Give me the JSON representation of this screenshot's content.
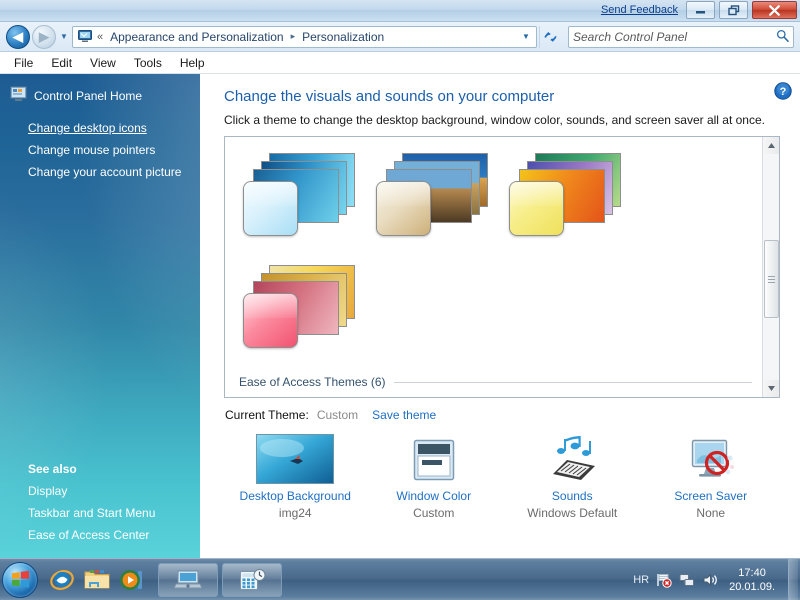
{
  "titlebar": {
    "send_feedback": "Send Feedback",
    "minimize_label": "Minimize",
    "restore_label": "Restore",
    "close_label": "Close"
  },
  "navbar": {
    "back_label": "Back",
    "forward_label": "Forward",
    "recent_dropdown_label": "Recent pages",
    "address_icon": "control-panel-monitor-icon",
    "overflow_chevrons": "«",
    "breadcrumbs": [
      {
        "label": "Appearance and Personalization"
      },
      {
        "label": "Personalization"
      }
    ],
    "breadcrumb_separator": "▸",
    "address_dropdown": "▼",
    "refresh_label": "Refresh",
    "search": {
      "value": "",
      "placeholder": "Search Control Panel",
      "icon": "search-icon"
    }
  },
  "menubar": {
    "items": [
      {
        "label": "File"
      },
      {
        "label": "Edit"
      },
      {
        "label": "View"
      },
      {
        "label": "Tools"
      },
      {
        "label": "Help"
      }
    ]
  },
  "sidebar": {
    "home": {
      "label": "Control Panel Home",
      "icon": "control-panel-home-icon"
    },
    "links": [
      {
        "label": "Change desktop icons",
        "active": true
      },
      {
        "label": "Change mouse pointers",
        "active": false
      },
      {
        "label": "Change your account picture",
        "active": false
      }
    ],
    "see_also_title": "See also",
    "see_also": [
      {
        "label": "Display"
      },
      {
        "label": "Taskbar and Start Menu"
      },
      {
        "label": "Ease of Access Center"
      }
    ]
  },
  "content": {
    "help_label": "Help",
    "title": "Change the visuals and sounds on your computer",
    "subtitle": "Click a theme to change the desktop background, window color, sounds, and screen saver all at once.",
    "themes": [
      {
        "name": "theme-ocean",
        "wallpapers": [
          "linear-gradient(120deg,#1a5f93 0%,#2f93c9 40%,#6fd0ea 100%)",
          "linear-gradient(110deg,#0f4e86 0%,#2b8fc6 45%,#79d6ef 100%)",
          "linear-gradient(100deg,#166ba4 0%,#3aa4d6 50%,#8fe0f5 100%)"
        ],
        "glass": "linear-gradient(140deg,#f2fbff 0%,#d9f1fc 45%,#a8def5 100%)"
      },
      {
        "name": "theme-landscapes",
        "wallpapers": [
          "linear-gradient(to bottom,#6fa8d4 0%,#6fa8d4 35%,#b6894f 36%,#4c3a24 100%)",
          "linear-gradient(to bottom,#74b0d8 0%,#74b0d8 40%,#caa35f 41%,#8a7340 100%)",
          "linear-gradient(to bottom,#1f5fa8 0%,#2c7cc4 45%,#d9a452 46%,#a06a28 100%)"
        ],
        "glass": "linear-gradient(140deg,#f7f3e6 0%,#e9dcc0 45%,#cdb079 100%)"
      },
      {
        "name": "theme-architecture",
        "wallpapers": [
          "linear-gradient(120deg,#f3c419 0%,#f08a1c 45%,#e4541a 100%)",
          "linear-gradient(120deg,#4b4fae 0%,#9a77c4 50%,#d9c3e4 100%)",
          "linear-gradient(120deg,#1d7a58 0%,#41a96f 50%,#b8dc8a 100%)"
        ],
        "glass": "linear-gradient(140deg,#fdf8c8 0%,#f7ee8a 45%,#efe05a 100%)"
      },
      {
        "name": "theme-nature",
        "wallpapers": [
          "linear-gradient(120deg,#b2465c 0%,#d4707f 45%,#efb6bf 100%)",
          "linear-gradient(120deg,#c4922c 0%,#dbb24d 45%,#f0da8c 100%)",
          "linear-gradient(120deg,#f0e3a8 0%,#f6d85c 40%,#e8a83a 100%)"
        ],
        "glass": "linear-gradient(140deg,#ffd5dd 0%,#fb8b9f 45%,#f1526f 100%)"
      }
    ],
    "group_header": "Ease of Access Themes (6)",
    "current_theme_label": "Current Theme:",
    "current_theme_value": "Custom",
    "save_theme_link": "Save theme",
    "settings": [
      {
        "name": "Desktop Background",
        "value": "img24",
        "icon": "desktop-background-icon"
      },
      {
        "name": "Window Color",
        "value": "Custom",
        "icon": "window-color-icon"
      },
      {
        "name": "Sounds",
        "value": "Windows Default",
        "icon": "sounds-icon"
      },
      {
        "name": "Screen Saver",
        "value": "None",
        "icon": "screen-saver-icon"
      }
    ]
  },
  "taskbar": {
    "start_label": "Start",
    "quick_launch": [
      {
        "name": "internet-explorer-icon",
        "label": "Internet Explorer"
      },
      {
        "name": "windows-explorer-icon",
        "label": "Windows Explorer"
      },
      {
        "name": "media-player-icon",
        "label": "Windows Media Player"
      }
    ],
    "tasks": [
      {
        "name": "task-personalization",
        "label": "Personalization"
      },
      {
        "name": "task-calculator",
        "label": "Calculator"
      }
    ],
    "tray": {
      "language": "HR",
      "icons": [
        {
          "name": "action-center-flag-icon",
          "label": "Action Center"
        },
        {
          "name": "network-icon",
          "label": "Network"
        },
        {
          "name": "volume-icon",
          "label": "Volume"
        }
      ],
      "time": "17:40",
      "date": "20.01.09.",
      "show_desktop_label": "Show desktop"
    }
  },
  "colors": {
    "accent_blue": "#1f6fc4",
    "title_blue": "#1c5fae",
    "sidebar_top": "#1d5c93",
    "sidebar_bottom": "#5ad2da",
    "close_red": "#b93522"
  }
}
